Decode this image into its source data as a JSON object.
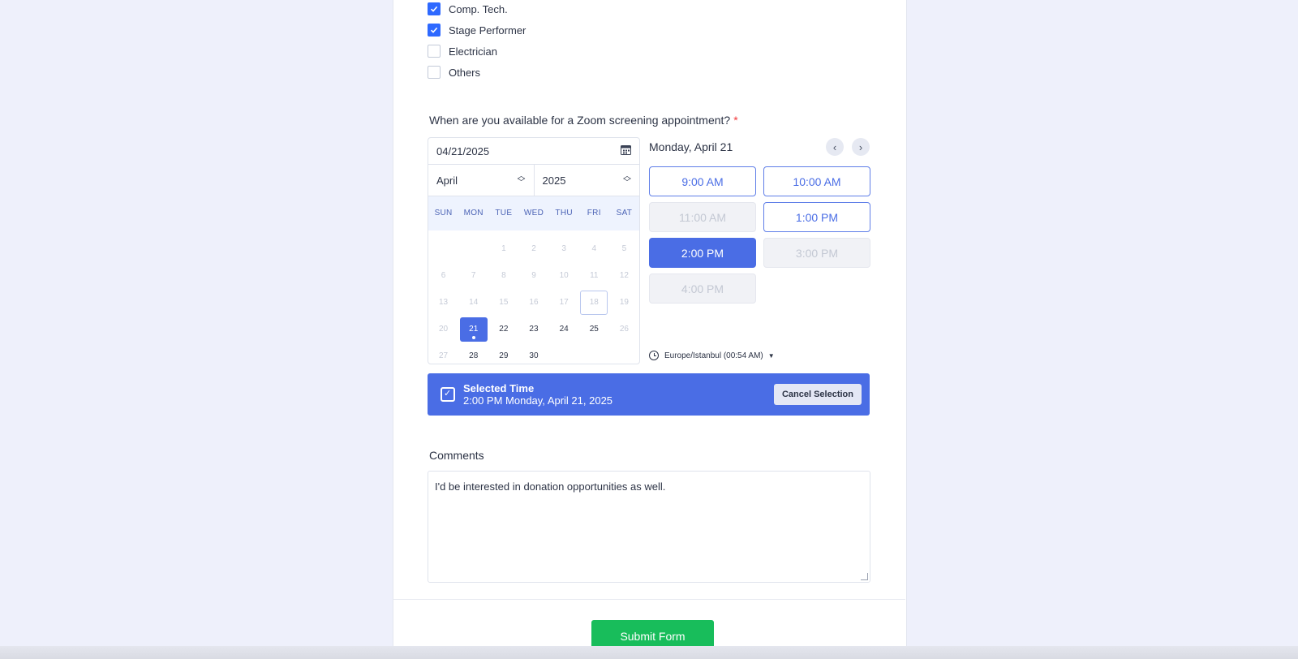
{
  "options": [
    {
      "label": "Comp. Tech.",
      "checked": true
    },
    {
      "label": "Stage Performer",
      "checked": true
    },
    {
      "label": "Electrician",
      "checked": false
    },
    {
      "label": "Others",
      "checked": false
    }
  ],
  "question": {
    "text": "When are you available for a Zoom screening appointment?",
    "required_mark": "*"
  },
  "calendar": {
    "date_value": "04/21/2025",
    "month": "April",
    "year": "2025",
    "weekdays": [
      "SUN",
      "MON",
      "TUE",
      "WED",
      "THU",
      "FRI",
      "SAT"
    ],
    "weeks": [
      [
        "",
        "",
        "1",
        "2",
        "3",
        "4",
        "5"
      ],
      [
        "6",
        "7",
        "8",
        "9",
        "10",
        "11",
        "12"
      ],
      [
        "13",
        "14",
        "15",
        "16",
        "17",
        "18",
        "19"
      ],
      [
        "20",
        "21",
        "22",
        "23",
        "24",
        "25",
        "26"
      ],
      [
        "27",
        "28",
        "29",
        "30",
        "",
        "",
        ""
      ]
    ],
    "available_days": [
      "21",
      "22",
      "23",
      "24",
      "25",
      "28",
      "29",
      "30"
    ],
    "today": "18",
    "selected": "21"
  },
  "slots": {
    "date_title": "Monday, April 21",
    "items": [
      {
        "label": "9:00 AM",
        "state": "open"
      },
      {
        "label": "10:00 AM",
        "state": "open"
      },
      {
        "label": "11:00 AM",
        "state": "disabled"
      },
      {
        "label": "1:00 PM",
        "state": "open"
      },
      {
        "label": "2:00 PM",
        "state": "active"
      },
      {
        "label": "3:00 PM",
        "state": "disabled"
      },
      {
        "label": "4:00 PM",
        "state": "disabled"
      }
    ],
    "timezone": "Europe/Istanbul (00:54 AM)"
  },
  "selected_time": {
    "title": "Selected Time",
    "value": "2:00 PM Monday, April 21, 2025",
    "cancel_label": "Cancel Selection"
  },
  "comments": {
    "label": "Comments",
    "value": "I'd be interested in donation opportunities as well."
  },
  "submit_label": "Submit Form",
  "colors": {
    "accent": "#4a6de5",
    "submit": "#18bd5b",
    "checkbox": "#2e69ff",
    "required": "#f23a3c"
  }
}
